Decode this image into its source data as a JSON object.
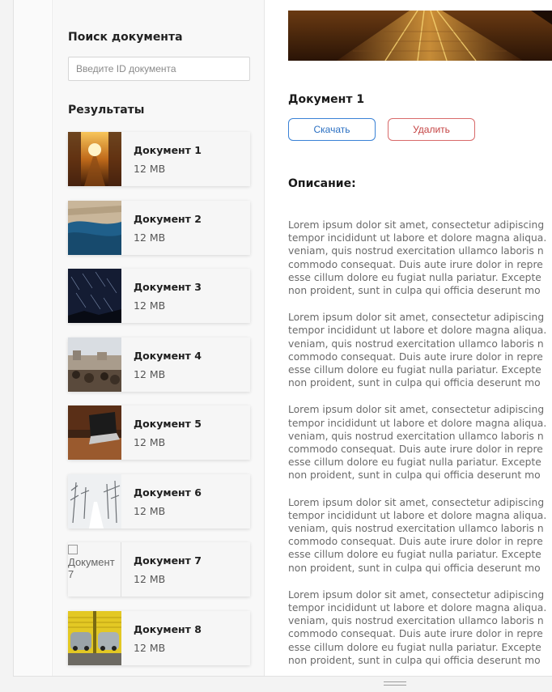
{
  "sidebar": {
    "search_title": "Поиск документа",
    "search_placeholder": "Введите ID документа",
    "results_title": "Результаты",
    "results": [
      {
        "name": "Документ 1",
        "size": "12 MB",
        "thumb": "street-sunset"
      },
      {
        "name": "Документ 2",
        "size": "12 MB",
        "thumb": "coastal-city"
      },
      {
        "name": "Документ 3",
        "size": "12 MB",
        "thumb": "star-trails"
      },
      {
        "name": "Документ 4",
        "size": "12 MB",
        "thumb": "city-crowd"
      },
      {
        "name": "Документ 5",
        "size": "12 MB",
        "thumb": "laptop-desk"
      },
      {
        "name": "Документ 6",
        "size": "12 MB",
        "thumb": "snowy-road"
      },
      {
        "name": "Документ 7",
        "size": "12 MB",
        "thumb": "broken-image",
        "alt": "Документ 7"
      },
      {
        "name": "Документ 8",
        "size": "12 MB",
        "thumb": "parked-cars"
      }
    ]
  },
  "detail": {
    "title": "Документ 1",
    "download_label": "Скачать",
    "delete_label": "Удалить",
    "description_heading": "Описание:",
    "paragraphs": [
      "Lorem ipsum dolor sit amet, consectetur adipiscing\ntempor incididunt ut labore et dolore magna aliqua.\nveniam, quis nostrud exercitation ullamco laboris n\ncommodo consequat. Duis aute irure dolor in repre\nesse cillum dolore eu fugiat nulla pariatur. Excepte\nnon proident, sunt in culpa qui officia deserunt mo",
      "Lorem ipsum dolor sit amet, consectetur adipiscing\ntempor incididunt ut labore et dolore magna aliqua.\nveniam, quis nostrud exercitation ullamco laboris n\ncommodo consequat. Duis aute irure dolor in repre\nesse cillum dolore eu fugiat nulla pariatur. Excepte\nnon proident, sunt in culpa qui officia deserunt mo",
      "Lorem ipsum dolor sit amet, consectetur adipiscing\ntempor incididunt ut labore et dolore magna aliqua.\nveniam, quis nostrud exercitation ullamco laboris n\ncommodo consequat. Duis aute irure dolor in repre\nesse cillum dolore eu fugiat nulla pariatur. Excepte\nnon proident, sunt in culpa qui officia deserunt mo",
      "Lorem ipsum dolor sit amet, consectetur adipiscing\ntempor incididunt ut labore et dolore magna aliqua.\nveniam, quis nostrud exercitation ullamco laboris n\ncommodo consequat. Duis aute irure dolor in repre\nesse cillum dolore eu fugiat nulla pariatur. Excepte\nnon proident, sunt in culpa qui officia deserunt mo",
      "Lorem ipsum dolor sit amet, consectetur adipiscing\ntempor incididunt ut labore et dolore magna aliqua.\nveniam, quis nostrud exercitation ullamco laboris n\ncommodo consequat. Duis aute irure dolor in repre\nesse cillum dolore eu fugiat nulla pariatur. Excepte\nnon proident, sunt in culpa qui officia deserunt mo"
    ]
  },
  "colors": {
    "download_border": "#3a82d6",
    "delete_border": "#d86a6a",
    "body_text": "#6a6a6a"
  }
}
